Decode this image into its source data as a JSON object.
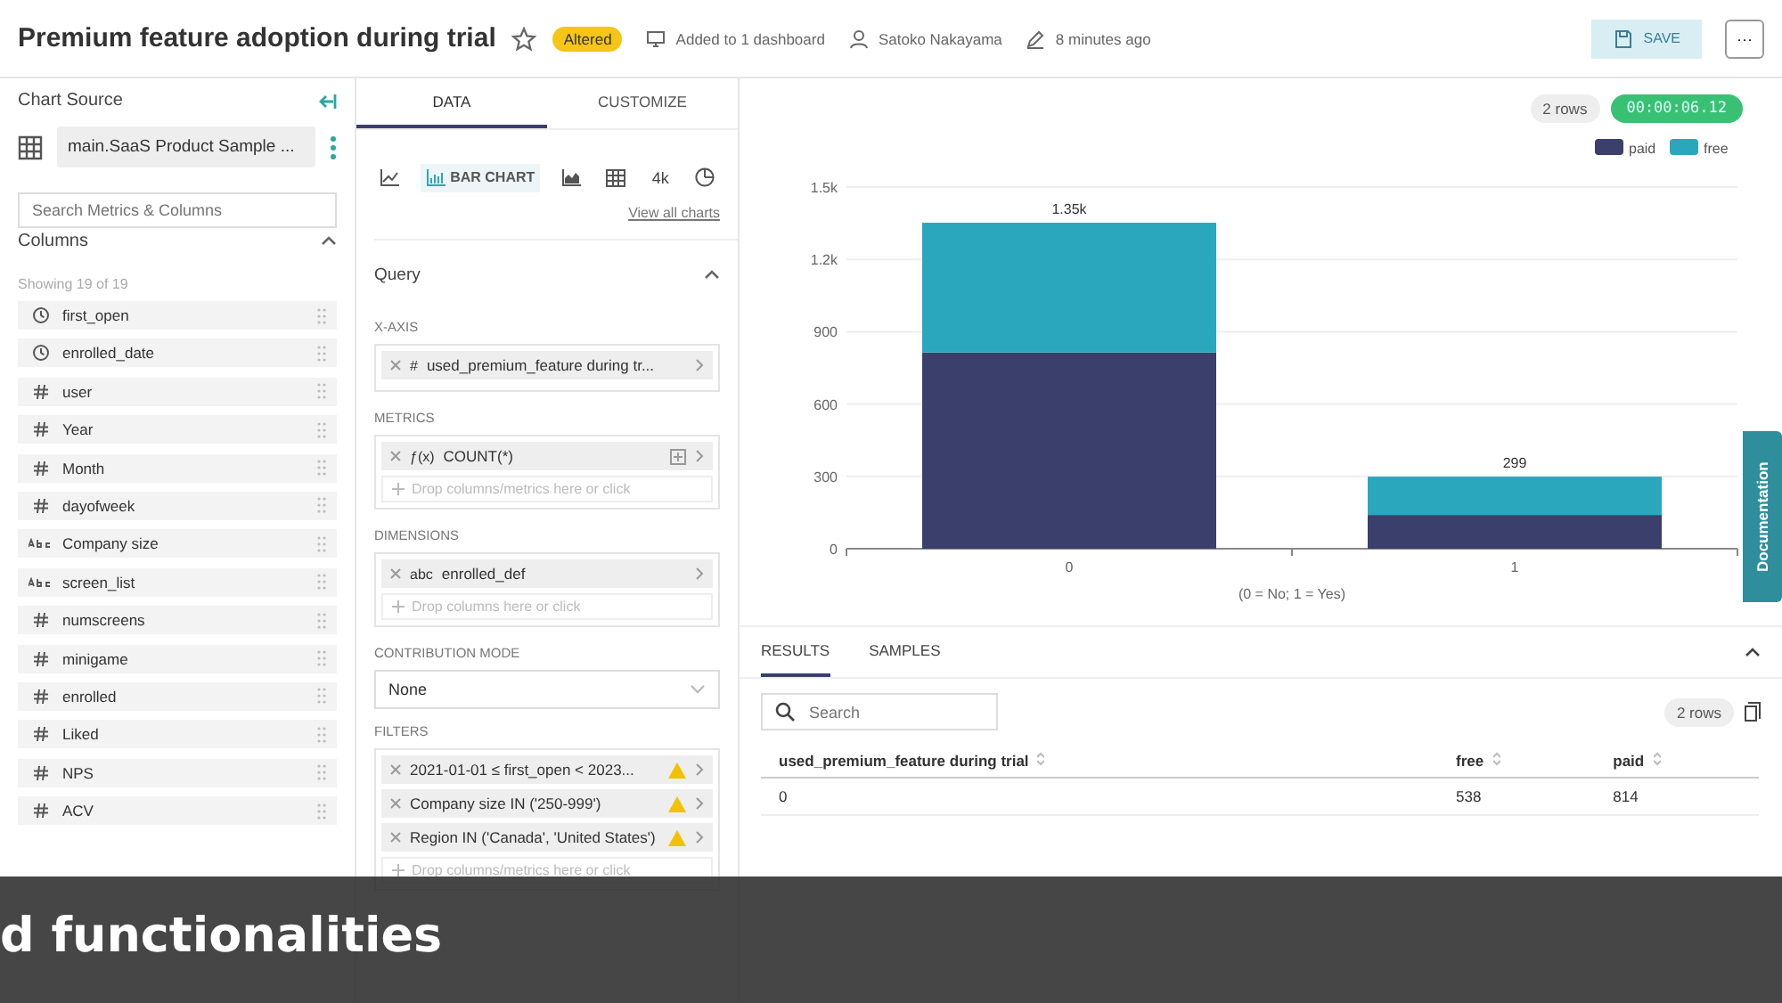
{
  "header": {
    "title": "Premium feature adoption during trial",
    "starred": false,
    "badge": "Altered",
    "meta": [
      {
        "kind": "dashboard",
        "text": "Added to 1 dashboard"
      },
      {
        "kind": "user",
        "text": "Satoko Nakayama"
      },
      {
        "kind": "edit",
        "text": "8 minutes ago"
      }
    ],
    "save": "SAVE",
    "more": "···"
  },
  "source": {
    "title": "Chart Source",
    "dataset": "main.SaaS Product Sample ...",
    "search_placeholder": "Search Metrics & Columns",
    "columns_title": "Columns",
    "showing": "Showing 19 of 19",
    "columns": [
      {
        "kind": "time",
        "name": "first_open"
      },
      {
        "kind": "time",
        "name": "enrolled_date"
      },
      {
        "kind": "num",
        "name": "user"
      },
      {
        "kind": "num",
        "name": "Year"
      },
      {
        "kind": "num",
        "name": "Month"
      },
      {
        "kind": "num",
        "name": "dayofweek"
      },
      {
        "kind": "text",
        "name": "Company size"
      },
      {
        "kind": "text",
        "name": "screen_list"
      },
      {
        "kind": "num",
        "name": "numscreens"
      },
      {
        "kind": "num",
        "name": "minigame"
      },
      {
        "kind": "num",
        "name": "enrolled"
      },
      {
        "kind": "num",
        "name": "Liked"
      },
      {
        "kind": "num",
        "name": "NPS"
      },
      {
        "kind": "num",
        "name": "ACV"
      }
    ]
  },
  "builder": {
    "tabs": [
      {
        "label": "DATA",
        "selected": true
      },
      {
        "label": "CUSTOMIZE",
        "selected": false
      }
    ],
    "chart_types": [
      {
        "kind": "line",
        "selected": false
      },
      {
        "kind": "bar",
        "label": "BAR CHART",
        "selected": true
      },
      {
        "kind": "area",
        "selected": false
      },
      {
        "kind": "table",
        "selected": false
      },
      {
        "kind": "kpi",
        "label": "4k",
        "selected": false
      },
      {
        "kind": "pie",
        "selected": false
      }
    ],
    "view_all": "View all charts",
    "query_title": "Query",
    "x_axis": {
      "label": "X-AXIS",
      "items": [
        {
          "type": "#",
          "text": "used_premium_feature during tr..."
        }
      ]
    },
    "metrics": {
      "label": "METRICS",
      "items": [
        {
          "type": "ƒ(x)",
          "text": "COUNT(*)"
        }
      ],
      "drop": "Drop columns/metrics here or click"
    },
    "dimensions": {
      "label": "DIMENSIONS",
      "items": [
        {
          "type": "abc",
          "text": "enrolled_def"
        }
      ],
      "drop": "Drop columns here or click"
    },
    "contribution": {
      "label": "CONTRIBUTION MODE",
      "value": "None"
    },
    "filters": {
      "label": "FILTERS",
      "items": [
        {
          "text": "2021-01-01 ≤ first_open < 2023...",
          "warning": true
        },
        {
          "text": "Company size IN ('250-999')",
          "warning": true
        },
        {
          "text": "Region IN ('Canada', 'United States')",
          "warning": true
        }
      ],
      "drop": "Drop columns/metrics here or click"
    }
  },
  "chart": {
    "rows": "2 rows",
    "timer": "00:00:06.12",
    "documentation": "Documentation",
    "chart_data": {
      "type": "bar",
      "stacked": true,
      "grid": true,
      "legend": true,
      "categories": [
        "0",
        "1"
      ],
      "series": [
        {
          "name": "paid",
          "color": "#3b3f6b",
          "values": [
            814,
            140
          ]
        },
        {
          "name": "free",
          "color": "#2aa7bd",
          "values": [
            538,
            159
          ]
        }
      ],
      "ylim": [
        0,
        1500
      ],
      "yticks": [
        0,
        300,
        600,
        900,
        {
          "value": 1200,
          "label": "1.2k"
        },
        {
          "value": 1500,
          "label": "1.5k"
        }
      ],
      "xlabel": "(0 = No; 1 = Yes)",
      "value_labels": [
        "1.35k",
        "299"
      ]
    }
  },
  "results": {
    "tabs": [
      {
        "label": "RESULTS",
        "selected": true
      },
      {
        "label": "SAMPLES",
        "selected": false
      }
    ],
    "search_placeholder": "Search",
    "rows": "2 rows",
    "columns": [
      "used_premium_feature during trial",
      "free",
      "paid"
    ],
    "rows_data": [
      [
        "0",
        "538",
        "814"
      ]
    ]
  },
  "caption": "d functionalities"
}
